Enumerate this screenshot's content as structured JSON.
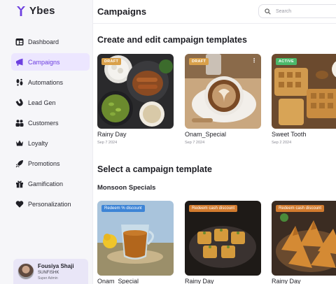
{
  "brand": {
    "name": "Ybes",
    "color": "#6d3fe0"
  },
  "header": {
    "title": "Campaigns",
    "search_placeholder": "Search"
  },
  "sidebar": {
    "items": [
      {
        "label": "Dashboard",
        "icon": "table-icon"
      },
      {
        "label": "Campaigns",
        "icon": "megaphone-icon",
        "active": true
      },
      {
        "label": "Automations",
        "icon": "footsteps-icon"
      },
      {
        "label": "Lead Gen",
        "icon": "magnet-icon"
      },
      {
        "label": "Customers",
        "icon": "users-icon"
      },
      {
        "label": "Loyalty",
        "icon": "crown-icon"
      },
      {
        "label": "Promotions",
        "icon": "rocket-icon"
      },
      {
        "label": "Gamification",
        "icon": "gift-icon"
      },
      {
        "label": "Personalization",
        "icon": "heart-icon"
      }
    ]
  },
  "profile": {
    "name": "Fousiya Shaji",
    "org": "SUNFISHK",
    "role": "Super Admin"
  },
  "templates_section": {
    "title": "Create and edit campaign templates",
    "cards": [
      {
        "name": "Rainy Day",
        "date": "Sep 7 2024",
        "status": "DRAFT"
      },
      {
        "name": "Onam_Special",
        "date": "Sep 7 2024",
        "status": "DRAFT"
      },
      {
        "name": "Sweet Tooth",
        "date": "Sep 2 2024",
        "status": "ACTIVE"
      }
    ]
  },
  "select_section": {
    "title": "Select a campaign template",
    "group": "Monsoon Specials",
    "cards": [
      {
        "name": "Onam_Special",
        "tag": "Redeem % discount"
      },
      {
        "name": "Rainy Day",
        "tag": "Redeem cash discount"
      },
      {
        "name": "Rainy Day",
        "tag": "Redeem cash discount"
      }
    ]
  }
}
